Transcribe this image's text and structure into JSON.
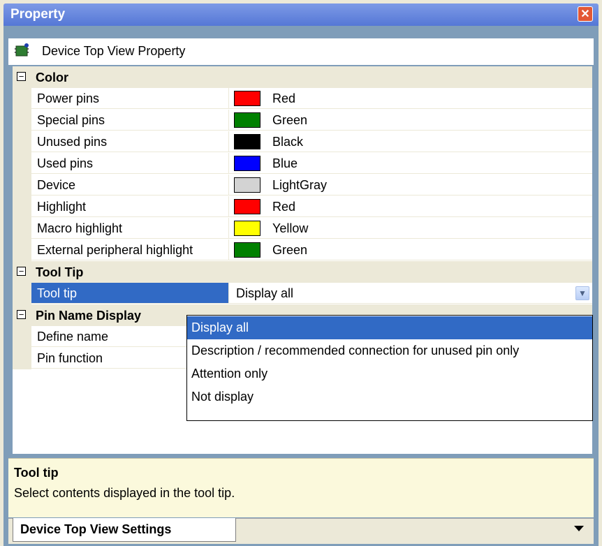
{
  "window": {
    "title": "Property",
    "close_icon": "close-icon"
  },
  "header": {
    "icon": "chip-icon",
    "label": "Device Top View Property"
  },
  "categories": {
    "color": {
      "label": "Color",
      "rows": [
        {
          "name": "Power pins",
          "value": "Red",
          "color": "#ff0000"
        },
        {
          "name": "Special pins",
          "value": "Green",
          "color": "#008000"
        },
        {
          "name": "Unused pins",
          "value": "Black",
          "color": "#000000"
        },
        {
          "name": "Used pins",
          "value": "Blue",
          "color": "#0000ff"
        },
        {
          "name": "Device",
          "value": "LightGray",
          "color": "#d3d3d3"
        },
        {
          "name": "Highlight",
          "value": "Red",
          "color": "#ff0000"
        },
        {
          "name": "Macro highlight",
          "value": "Yellow",
          "color": "#ffff00"
        },
        {
          "name": "External peripheral highlight",
          "value": "Green",
          "color": "#008000"
        }
      ]
    },
    "tooltip": {
      "label": "Tool Tip",
      "rows": [
        {
          "name": "Tool tip",
          "value": "Display all"
        }
      ]
    },
    "pinname": {
      "label": "Pin Name Display",
      "rows": [
        {
          "name": "Define name"
        },
        {
          "name": "Pin function"
        }
      ]
    }
  },
  "dropdown": {
    "options": [
      "Display all",
      "Description / recommended connection for unused pin only",
      "Attention only",
      "Not display"
    ],
    "selected": "Display all"
  },
  "description": {
    "title": "Tool tip",
    "text": "Select contents displayed in the tool tip."
  },
  "tabs": {
    "active": "Device Top View Settings"
  },
  "colors": {
    "selection": "#316ac5",
    "category_bg": "#ece9d8",
    "desc_bg": "#fbf9dc"
  }
}
